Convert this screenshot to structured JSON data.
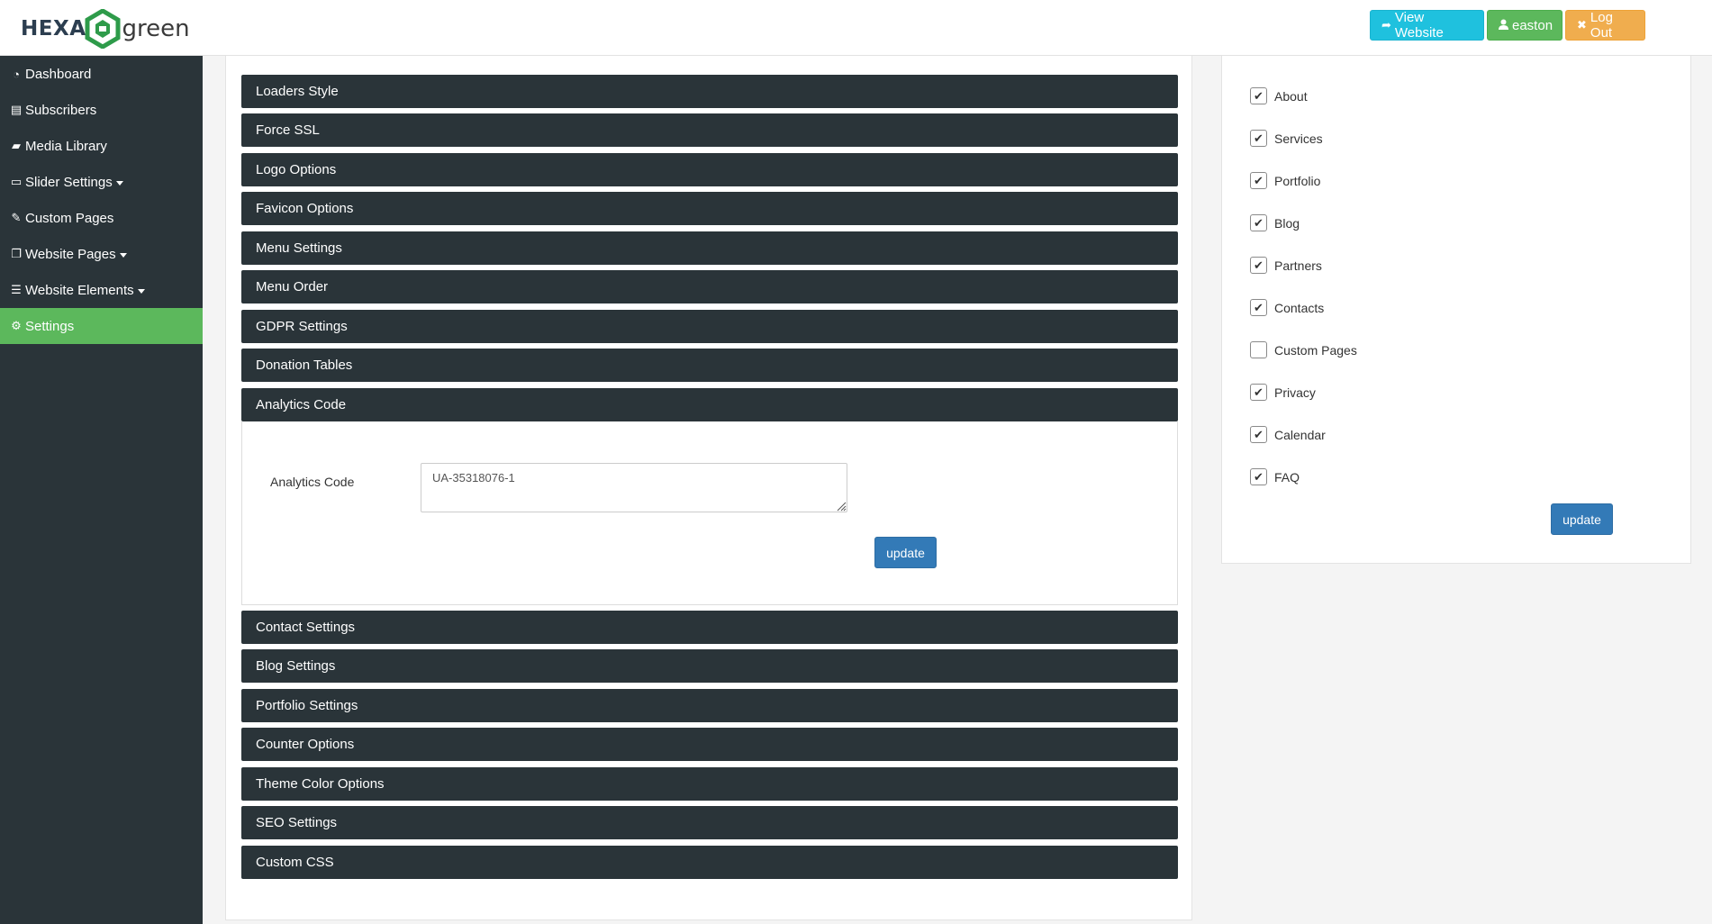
{
  "header": {
    "logo": {
      "text_hexa": "HEXA",
      "text_green": "green"
    },
    "buttons": {
      "view_website": "View Website",
      "user": "easton",
      "logout": "Log Out"
    }
  },
  "sidebar": {
    "items": [
      {
        "label": "Dashboard",
        "icon": "dashboard-icon"
      },
      {
        "label": "Subscribers",
        "icon": "newspaper-icon"
      },
      {
        "label": "Media Library",
        "icon": "folder-open-icon"
      },
      {
        "label": "Slider Settings",
        "icon": "desktop-icon",
        "dropdown": true
      },
      {
        "label": "Custom Pages",
        "icon": "edit-icon"
      },
      {
        "label": "Website Pages",
        "icon": "copy-icon",
        "dropdown": true
      },
      {
        "label": "Website Elements",
        "icon": "bars-icon",
        "dropdown": true
      },
      {
        "label": "Settings",
        "icon": "cogs-icon",
        "active": true
      }
    ]
  },
  "accordion": {
    "sections": [
      "Loaders Style",
      "Force SSL",
      "Logo Options",
      "Favicon Options",
      "Menu Settings",
      "Menu Order",
      "GDPR Settings",
      "Donation Tables",
      "Analytics Code",
      "Contact Settings",
      "Blog Settings",
      "Portfolio Settings",
      "Counter Options",
      "Theme Color Options",
      "SEO Settings",
      "Custom CSS"
    ],
    "analytics": {
      "label": "Analytics Code",
      "value": "UA-35318076-1",
      "update_label": "update"
    }
  },
  "menu_pages": {
    "items": [
      {
        "label": "About",
        "checked": true
      },
      {
        "label": "Services",
        "checked": true
      },
      {
        "label": "Portfolio",
        "checked": true
      },
      {
        "label": "Blog",
        "checked": true
      },
      {
        "label": "Partners",
        "checked": true
      },
      {
        "label": "Contacts",
        "checked": true
      },
      {
        "label": "Custom Pages",
        "checked": false
      },
      {
        "label": "Privacy",
        "checked": true
      },
      {
        "label": "Calendar",
        "checked": true
      },
      {
        "label": "FAQ",
        "checked": true
      }
    ],
    "update_label": "update"
  },
  "colors": {
    "sidebar_bg": "#2a3439",
    "active_green": "#5cb85c",
    "primary_blue": "#337ab7",
    "info_cyan": "#1fc1de",
    "warning_orange": "#f0ad4e"
  }
}
